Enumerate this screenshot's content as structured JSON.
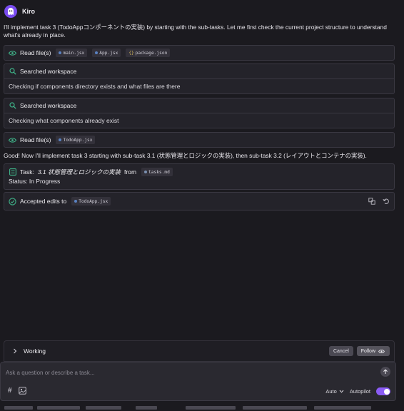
{
  "agent": {
    "name": "Kiro",
    "avatar_icon": "ghost-icon",
    "accent": "#7a4cf0"
  },
  "messages": {
    "intro": "I'll implement task 3 (TodoAppコンポーネントの実装) by starting with the sub-tasks. Let me first check the current project structure to understand what's already in place.",
    "good_now": "Good! Now I'll implement task 3 starting with sub-task 3.1 (状態管理とロジックの実装), then sub-task 3.2 (レイアウトとコンテナの実装)."
  },
  "read_files_1": {
    "label": "Read file(s)",
    "icon": "eye-icon",
    "files": [
      "main.jsx",
      "App.jsx",
      "package.json"
    ]
  },
  "search_1": {
    "label": "Searched workspace",
    "detail": "Checking if components directory exists and what files are there"
  },
  "search_2": {
    "label": "Searched workspace",
    "detail": "Checking what components already exist"
  },
  "read_files_2": {
    "label": "Read file(s)",
    "files": [
      "TodoApp.jsx"
    ]
  },
  "task": {
    "prefix": "Task:",
    "title": "3.1 状態管理とロジックの実装",
    "from": "from",
    "file": "tasks.md",
    "status": "Status: In Progress"
  },
  "accepted": {
    "label": "Accepted edits to",
    "file": "TodoApp.jsx"
  },
  "working": {
    "label": "Working",
    "cancel": "Cancel",
    "follow": "Follow"
  },
  "input": {
    "placeholder": "Ask a question or describe a task...",
    "mode": "Auto",
    "autopilot": "Autopilot",
    "autopilot_on": true
  },
  "colors": {
    "accent_toggle": "#8b5cf6",
    "eye_icon": "#3fb58a",
    "check_icon": "#3fb58a"
  }
}
